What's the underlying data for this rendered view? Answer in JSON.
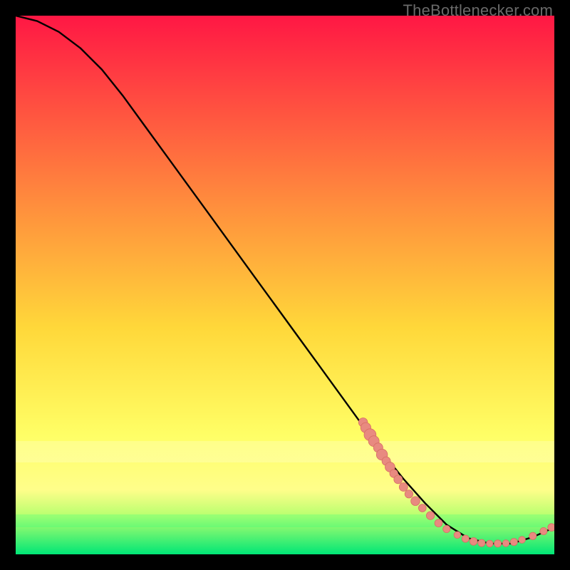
{
  "watermark": "TheBottlenecker.com",
  "colors": {
    "bg_top": "#ff1744",
    "bg_upper_mid": "#ff8a3d",
    "bg_mid": "#ffd83a",
    "bg_lower_mid": "#ffff66",
    "bg_band_yellow": "#fffe8a",
    "bg_band_lime": "#b6ff6e",
    "bg_band_green": "#00e676",
    "line": "#000000",
    "dot_fill": "#e88a80",
    "dot_stroke": "#d76e63"
  },
  "chart_data": {
    "type": "line",
    "title": "",
    "xlabel": "",
    "ylabel": "",
    "xlim": [
      0,
      100
    ],
    "ylim": [
      0,
      100
    ],
    "series": [
      {
        "name": "curve",
        "x": [
          0,
          4,
          8,
          12,
          16,
          20,
          24,
          28,
          32,
          36,
          40,
          44,
          48,
          52,
          56,
          60,
          64,
          68,
          72,
          76,
          80,
          84,
          88,
          92,
          96,
          100
        ],
        "y": [
          100,
          99,
          97,
          94,
          90,
          85,
          79.5,
          74,
          68.5,
          63,
          57.5,
          52,
          46.5,
          41,
          35.5,
          30,
          24.5,
          19,
          14,
          9.5,
          5.5,
          3,
          2,
          2,
          3.2,
          5
        ]
      }
    ],
    "points": [
      {
        "x": 64.5,
        "y": 24.5,
        "r": 1.05
      },
      {
        "x": 65.0,
        "y": 23.5,
        "r": 1.2
      },
      {
        "x": 65.8,
        "y": 22.2,
        "r": 1.4
      },
      {
        "x": 66.5,
        "y": 21.0,
        "r": 1.25
      },
      {
        "x": 67.3,
        "y": 19.8,
        "r": 1.1
      },
      {
        "x": 68.0,
        "y": 18.5,
        "r": 1.3
      },
      {
        "x": 68.8,
        "y": 17.3,
        "r": 1.0
      },
      {
        "x": 69.5,
        "y": 16.2,
        "r": 1.15
      },
      {
        "x": 70.2,
        "y": 15.0,
        "r": 0.95
      },
      {
        "x": 71.0,
        "y": 13.9,
        "r": 1.0
      },
      {
        "x": 72.0,
        "y": 12.5,
        "r": 1.0
      },
      {
        "x": 73.0,
        "y": 11.2,
        "r": 0.95
      },
      {
        "x": 74.2,
        "y": 9.9,
        "r": 1.05
      },
      {
        "x": 75.5,
        "y": 8.6,
        "r": 0.9
      },
      {
        "x": 77.0,
        "y": 7.2,
        "r": 0.95
      },
      {
        "x": 78.5,
        "y": 5.8,
        "r": 0.9
      },
      {
        "x": 80.0,
        "y": 4.7,
        "r": 0.85
      },
      {
        "x": 82.0,
        "y": 3.6,
        "r": 0.8
      },
      {
        "x": 83.5,
        "y": 2.9,
        "r": 0.85
      },
      {
        "x": 85.0,
        "y": 2.4,
        "r": 0.9
      },
      {
        "x": 86.5,
        "y": 2.1,
        "r": 0.85
      },
      {
        "x": 88.0,
        "y": 2.0,
        "r": 0.8
      },
      {
        "x": 89.5,
        "y": 2.0,
        "r": 0.85
      },
      {
        "x": 91.0,
        "y": 2.05,
        "r": 0.8
      },
      {
        "x": 92.5,
        "y": 2.3,
        "r": 0.85
      },
      {
        "x": 94.0,
        "y": 2.7,
        "r": 0.8
      },
      {
        "x": 96.0,
        "y": 3.4,
        "r": 0.85
      },
      {
        "x": 98.0,
        "y": 4.3,
        "r": 0.85
      },
      {
        "x": 99.5,
        "y": 5.0,
        "r": 0.9
      }
    ]
  }
}
